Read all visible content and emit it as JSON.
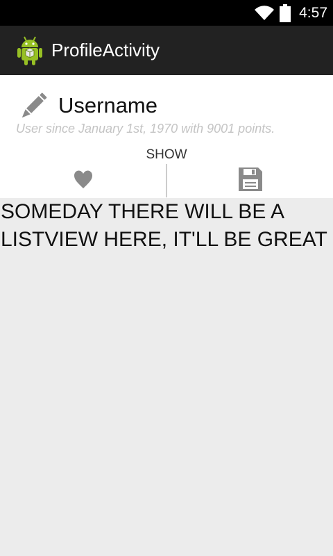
{
  "status_bar": {
    "time": "4:57",
    "icons": [
      "wifi-icon",
      "battery-icon"
    ]
  },
  "action_bar": {
    "title": "ProfileActivity",
    "icon": "android-icon"
  },
  "profile": {
    "icon": "pencil-icon",
    "username": "Username",
    "subtitle": "User since January 1st, 1970 with 9001 points.",
    "show_label": "SHOW",
    "actions": [
      {
        "icon": "heart-icon"
      },
      {
        "icon": "save-icon"
      }
    ]
  },
  "list": {
    "placeholder": "SOMEDAY THERE WILL BE A LISTVIEW HERE, IT'LL BE GREAT"
  },
  "colors": {
    "status_bar": "#000000",
    "action_bar": "#222222",
    "content_bg": "#ececec",
    "icon_gray": "#8a8a8a",
    "subtitle_gray": "#c4c4c4"
  }
}
